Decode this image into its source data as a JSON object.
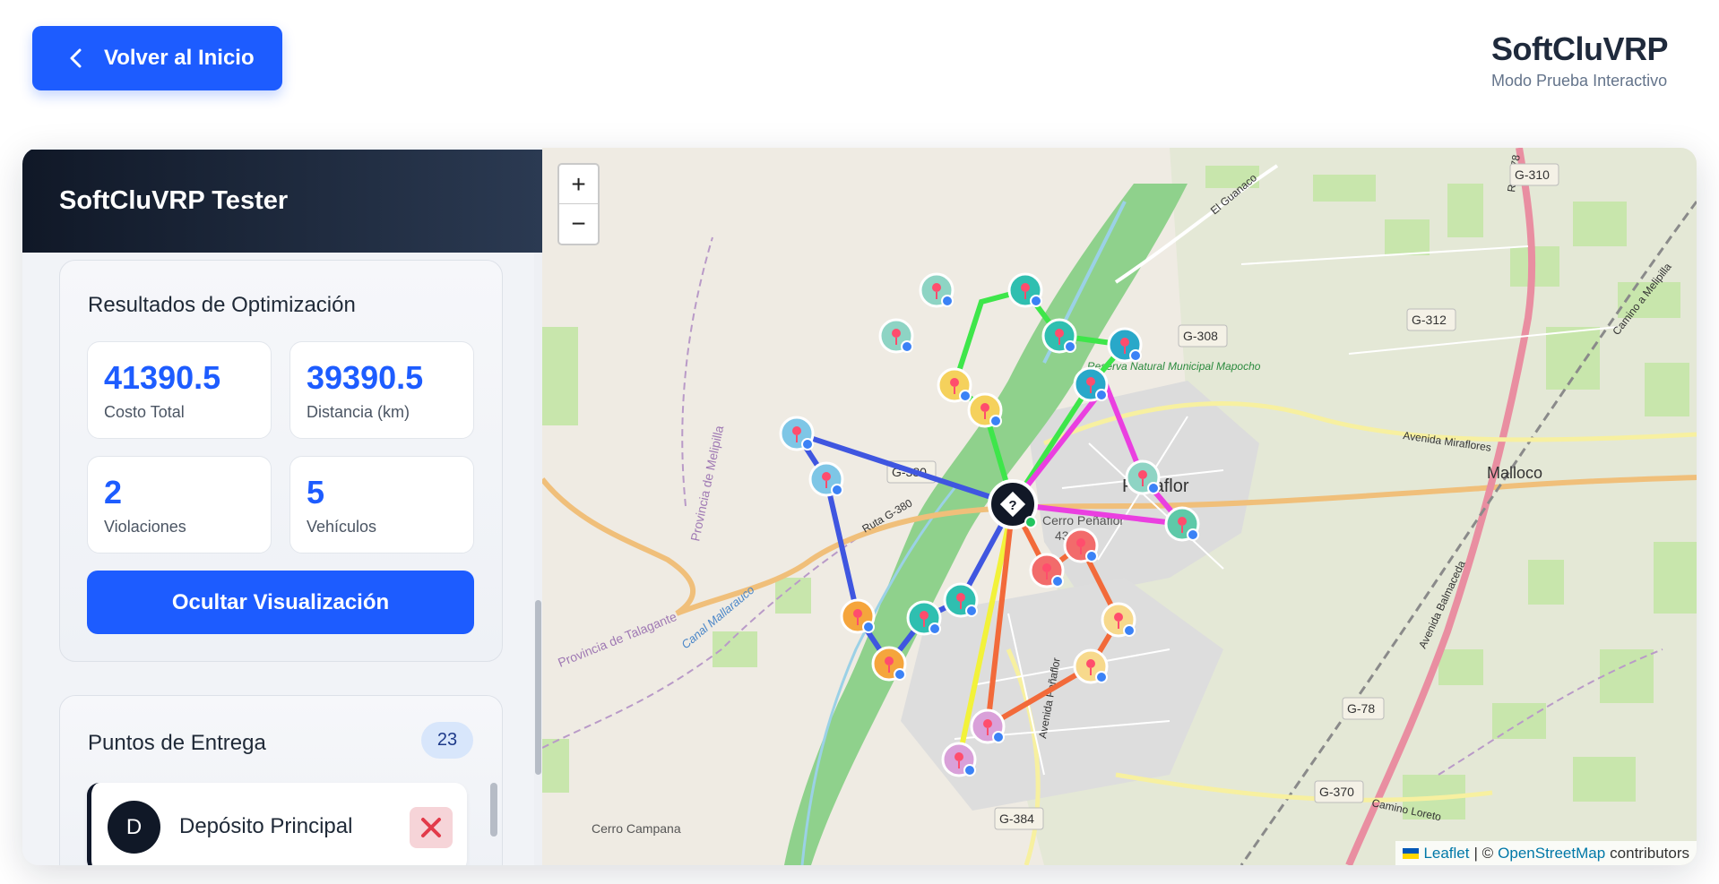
{
  "header": {
    "back_label": "Volver al Inicio",
    "brand_title": "SoftCluVRP",
    "brand_subtitle": "Modo Prueba Interactivo"
  },
  "sidebar": {
    "title": "SoftCluVRP Tester",
    "results": {
      "title": "Resultados de Optimización",
      "stats": [
        {
          "value": "41390.5",
          "label": "Costo Total"
        },
        {
          "value": "39390.5",
          "label": "Distancia (km)"
        },
        {
          "value": "2",
          "label": "Violaciones"
        },
        {
          "value": "5",
          "label": "Vehículos"
        }
      ],
      "toggle_label": "Ocultar Visualización"
    },
    "points": {
      "title": "Puntos de Entrega",
      "count": "23",
      "items": [
        {
          "initial": "D",
          "name": "Depósito Principal"
        }
      ]
    }
  },
  "map": {
    "zoom_in": "+",
    "zoom_out": "−",
    "attribution": {
      "leaflet": "Leaflet",
      "sep": "| ©",
      "osm": "OpenStreetMap",
      "tail": "contributors"
    },
    "labels": {
      "town": "Peñaflor",
      "malloco": "Malloco",
      "cerro": "Cerro Peñaflor",
      "cerro_alt": "430 m",
      "reserva": "Reserva Natural Municipal Mapocho",
      "cerro_campana": "Cerro Campana",
      "prov_melipilla": "Provincia de Melipilla",
      "prov_talagante": "Provincia de Talagante",
      "canal": "Canal Mallarauco",
      "ruta": "Ruta G-380",
      "av_miraflores": "Avenida Miraflores",
      "av_balmaceda": "Avenida Balmaceda",
      "av_penaflor": "Avenida Peñaflor",
      "camino_loreto": "Camino Loreto",
      "camino_melipilla": "Camino a Melipilla",
      "el_guanaco": "El Guanaco",
      "ruta78": "Ruta 78",
      "shields": [
        "G-310",
        "G-312",
        "G-308",
        "G-380",
        "G-78",
        "G-370",
        "G-384"
      ]
    },
    "route_colors": {
      "green": "#3ee64a",
      "blue": "#3f56e0",
      "magenta": "#ea3fe0",
      "yellow": "#f2f23a",
      "orange": "#f26a3a"
    }
  }
}
